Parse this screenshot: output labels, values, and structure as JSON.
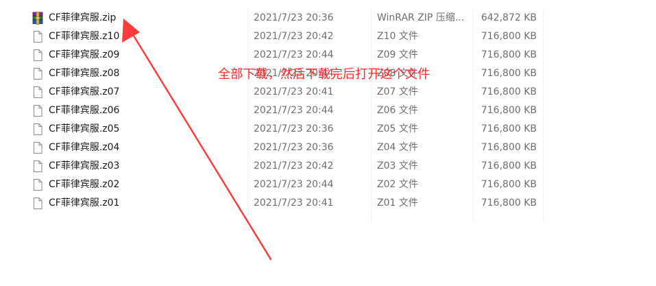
{
  "files": [
    {
      "name": "CF菲律宾服.zip",
      "date": "2021/7/23 20:36",
      "type": "WinRAR ZIP 压缩...",
      "size": "642,872 KB",
      "icon": "winrar-archive-icon"
    },
    {
      "name": "CF菲律宾服.z10",
      "date": "2021/7/23 20:42",
      "type": "Z10 文件",
      "size": "716,800 KB",
      "icon": "file-icon"
    },
    {
      "name": "CF菲律宾服.z09",
      "date": "2021/7/23 20:44",
      "type": "Z09 文件",
      "size": "716,800 KB",
      "icon": "file-icon"
    },
    {
      "name": "CF菲律宾服.z08",
      "date": "2021/7/23 20:44",
      "type": "Z08 文件",
      "size": "716,800 KB",
      "icon": "file-icon"
    },
    {
      "name": "CF菲律宾服.z07",
      "date": "2021/7/23 20:41",
      "type": "Z07 文件",
      "size": "716,800 KB",
      "icon": "file-icon"
    },
    {
      "name": "CF菲律宾服.z06",
      "date": "2021/7/23 20:44",
      "type": "Z06 文件",
      "size": "716,800 KB",
      "icon": "file-icon"
    },
    {
      "name": "CF菲律宾服.z05",
      "date": "2021/7/23 20:36",
      "type": "Z05 文件",
      "size": "716,800 KB",
      "icon": "file-icon"
    },
    {
      "name": "CF菲律宾服.z04",
      "date": "2021/7/23 20:36",
      "type": "Z04 文件",
      "size": "716,800 KB",
      "icon": "file-icon"
    },
    {
      "name": "CF菲律宾服.z03",
      "date": "2021/7/23 20:42",
      "type": "Z03 文件",
      "size": "716,800 KB",
      "icon": "file-icon"
    },
    {
      "name": "CF菲律宾服.z02",
      "date": "2021/7/23 20:44",
      "type": "Z02 文件",
      "size": "716,800 KB",
      "icon": "file-icon"
    },
    {
      "name": "CF菲律宾服.z01",
      "date": "2021/7/23 20:41",
      "type": "Z01 文件",
      "size": "716,800 KB",
      "icon": "file-icon"
    }
  ],
  "annotation": {
    "text": "全部下载，然后下载完后打开这个文件",
    "color": "#ff2828"
  },
  "colors": {
    "name_text": "#1a1a1a",
    "meta_text": "#6d6d6d",
    "annotation": "#ff2828"
  }
}
